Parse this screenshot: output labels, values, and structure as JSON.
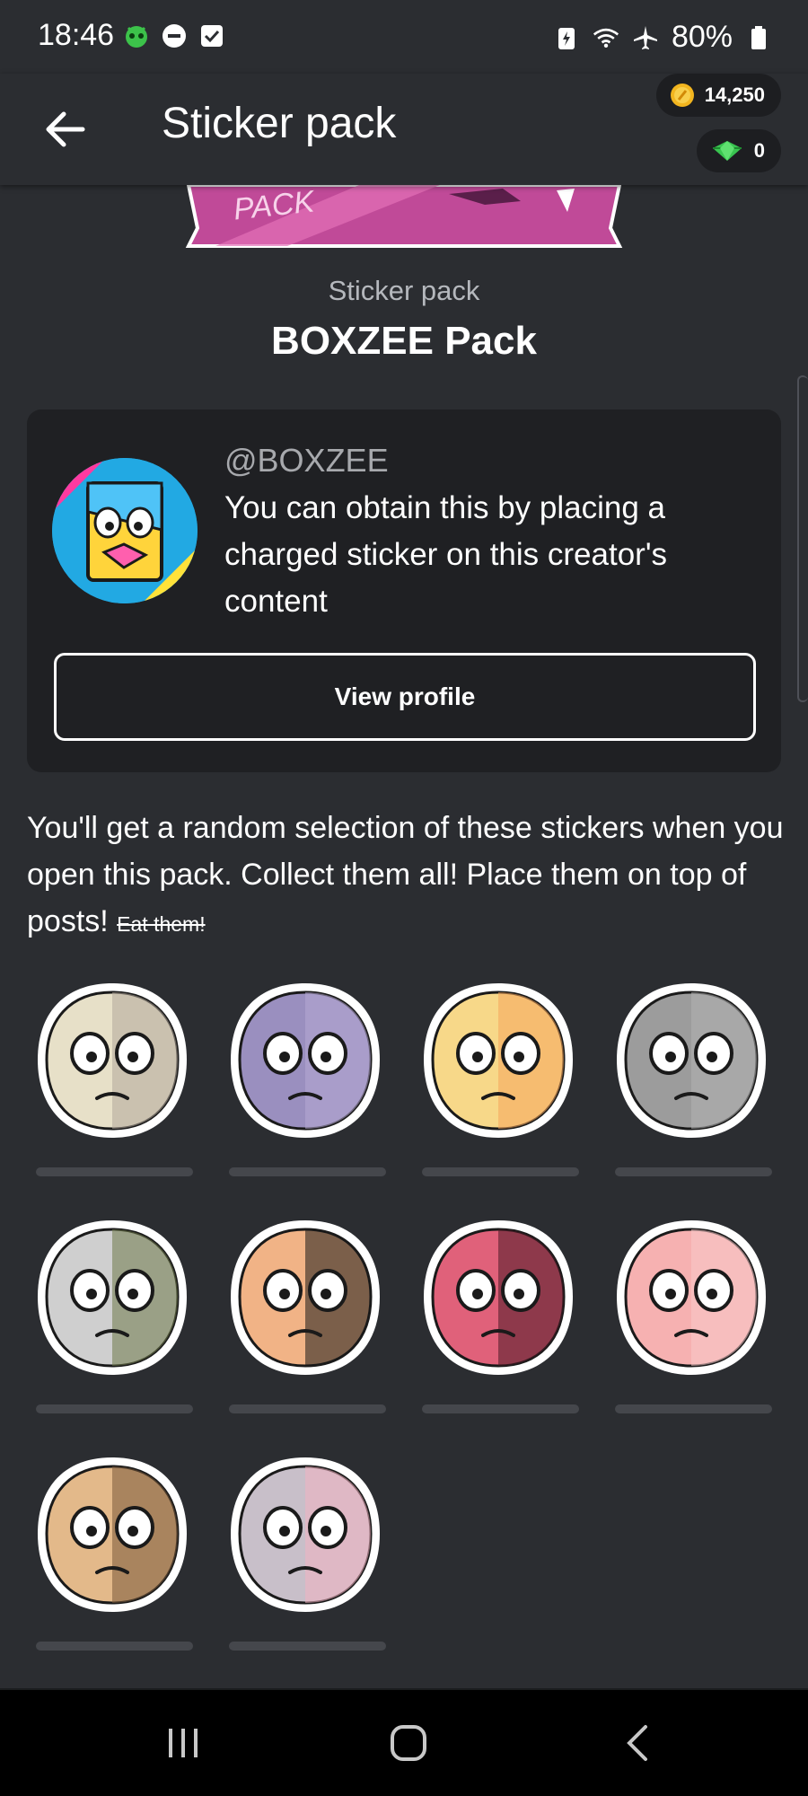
{
  "status_bar": {
    "time": "18:46",
    "battery": "80%"
  },
  "app_bar": {
    "title": "Sticker pack",
    "coins": "14,250",
    "gems": "0"
  },
  "pack": {
    "label": "Sticker pack",
    "name": "BOXZEE Pack",
    "banner_text": "PACK"
  },
  "creator": {
    "handle": "@BOXZEE",
    "description": "You can obtain this by placing a charged sticker on this creator's content",
    "view_profile_label": "View profile"
  },
  "description": {
    "text": "You'll get a random selection of these stickers when you open this pack. Collect them all! Place them on top of posts!",
    "strikethrough": "Eat them!"
  },
  "stickers": [
    {
      "name": "beige-tan-face",
      "colors": [
        "#e7e0c8",
        "#b3a89a"
      ]
    },
    {
      "name": "purple-round-face",
      "colors": [
        "#9a8fbf",
        "#b6aad4"
      ]
    },
    {
      "name": "yellow-orange-face",
      "colors": [
        "#f7d889",
        "#f5a65b"
      ]
    },
    {
      "name": "gray-scruffy-face",
      "colors": [
        "#9c9c9c",
        "#b3b3b3"
      ]
    },
    {
      "name": "helmet-soldier-face",
      "colors": [
        "#cfcfcf",
        "#6f7a4a"
      ]
    },
    {
      "name": "peach-dark-eye-face",
      "colors": [
        "#f1b386",
        "#1a1a1a"
      ]
    },
    {
      "name": "red-maroon-face",
      "colors": [
        "#e0617a",
        "#4a1a24"
      ]
    },
    {
      "name": "pink-fluffy-face",
      "colors": [
        "#f6b1b1",
        "#f8c8c8"
      ]
    },
    {
      "name": "tan-bald-face",
      "colors": [
        "#e3b98a",
        "#7a5a3a"
      ]
    },
    {
      "name": "lavender-flower-face",
      "colors": [
        "#c8bfc9",
        "#f3b3c1"
      ]
    }
  ],
  "colors": {
    "background": "#2b2d31",
    "card": "#1f2023",
    "nav": "#000000"
  }
}
